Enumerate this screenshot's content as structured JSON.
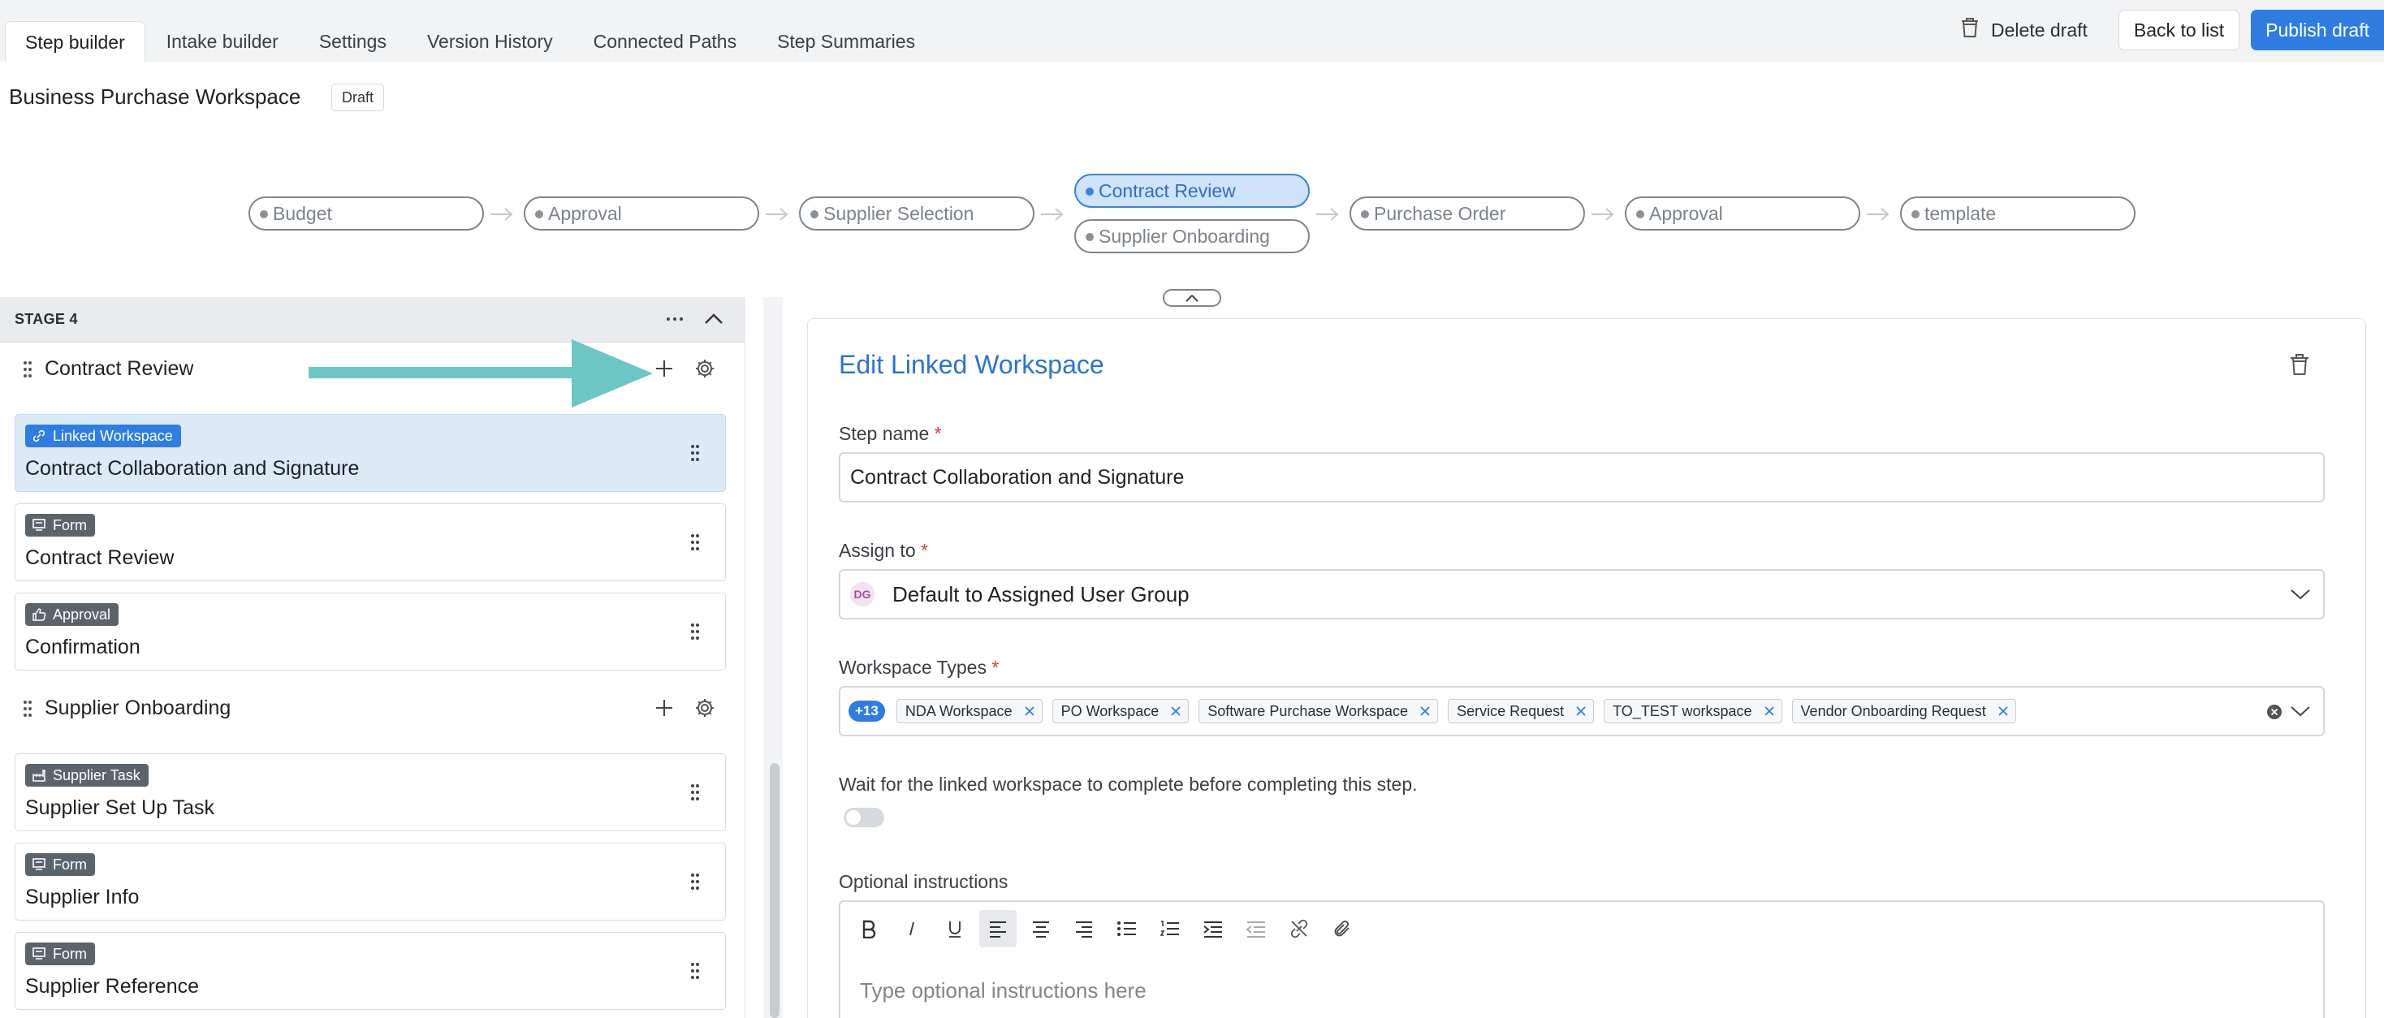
{
  "tabs": [
    {
      "label": "Step builder",
      "active": true
    },
    {
      "label": "Intake builder"
    },
    {
      "label": "Settings"
    },
    {
      "label": "Version History"
    },
    {
      "label": "Connected Paths"
    },
    {
      "label": "Step Summaries"
    }
  ],
  "header_actions": {
    "delete_draft": "Delete draft",
    "back_to_list": "Back to list",
    "publish_draft": "Publish draft"
  },
  "workflow": {
    "title": "Business Purchase Workspace",
    "status_badge": "Draft"
  },
  "pipeline": [
    {
      "label": "Budget"
    },
    {
      "label": "Approval"
    },
    {
      "label": "Supplier Selection"
    },
    {
      "label": "Contract Review",
      "active": true
    },
    {
      "label": "Supplier Onboarding"
    },
    {
      "label": "Purchase Order"
    },
    {
      "label": "Approval"
    },
    {
      "label": "template"
    }
  ],
  "stage": {
    "label": "STAGE 4",
    "groups": [
      {
        "title": "Contract Review",
        "steps": [
          {
            "type": "Linked Workspace",
            "name": "Contract Collaboration and Signature",
            "selected": true
          },
          {
            "type": "Form",
            "name": "Contract Review"
          },
          {
            "type": "Approval",
            "name": "Confirmation"
          }
        ]
      },
      {
        "title": "Supplier Onboarding",
        "steps": [
          {
            "type": "Supplier Task",
            "name": "Supplier Set Up Task"
          },
          {
            "type": "Form",
            "name": "Supplier Info"
          },
          {
            "type": "Form",
            "name": "Supplier Reference"
          }
        ]
      }
    ]
  },
  "edit_panel": {
    "title": "Edit Linked Workspace",
    "step_name_label": "Step name",
    "step_name_value": "Contract Collaboration and Signature",
    "assign_to_label": "Assign to",
    "assign_to_avatar": "DG",
    "assign_to_value": "Default to Assigned User Group",
    "workspace_types_label": "Workspace Types",
    "workspace_types_more": "+13",
    "workspace_types": [
      "NDA Workspace",
      "PO Workspace",
      "Software Purchase Workspace",
      "Service Request",
      "TO_TEST workspace",
      "Vendor Onboarding Request"
    ],
    "wait_label": "Wait for the linked workspace to complete before completing this step.",
    "wait_enabled": false,
    "instructions_label": "Optional instructions",
    "instructions_placeholder": "Type optional instructions here",
    "required_mark": "*"
  },
  "colors": {
    "accent": "#2f7de1",
    "selected_card": "#dceaf8",
    "annotation_arrow": "#6cc6c4"
  }
}
